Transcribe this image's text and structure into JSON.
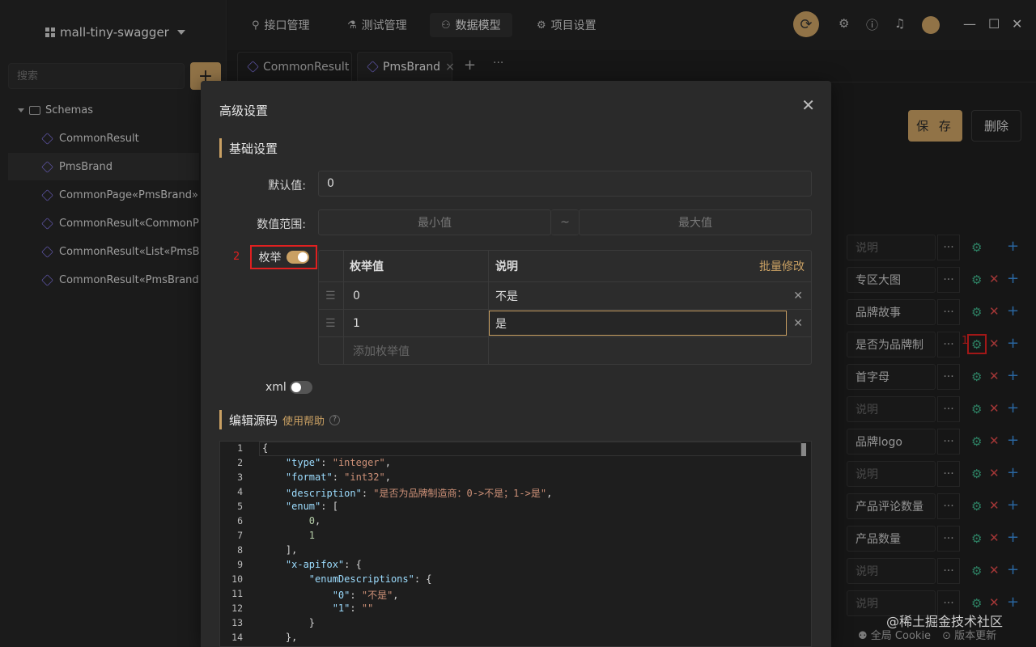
{
  "sidebar": {
    "project": "mall-tiny-swagger",
    "search_placeholder": "搜索",
    "add_label": "+",
    "folder": "Schemas",
    "items": [
      "CommonResult",
      "PmsBrand",
      "CommonPage«PmsBrand»",
      "CommonResult«CommonPage«PmsBrand»»",
      "CommonResult«List«PmsBrand»»",
      "CommonResult«PmsBrand»"
    ]
  },
  "topnav": {
    "tabs": [
      "接口管理",
      "测试管理",
      "数据模型",
      "项目设置"
    ]
  },
  "doctabs": [
    "CommonResult",
    "PmsBrand"
  ],
  "actions": {
    "save": "保 存",
    "delete": "删除"
  },
  "fields": [
    {
      "desc": "说明",
      "ph": true
    },
    {
      "desc": "专区大图"
    },
    {
      "desc": "品牌故事"
    },
    {
      "desc": "是否为品牌制"
    },
    {
      "desc": "首字母"
    },
    {
      "desc": "说明",
      "ph": true
    },
    {
      "desc": "品牌logo"
    },
    {
      "desc": "说明",
      "ph": true
    },
    {
      "desc": "产品评论数量"
    },
    {
      "desc": "产品数量"
    },
    {
      "desc": "说明",
      "ph": true
    },
    {
      "desc": "说明",
      "ph": true
    }
  ],
  "annotations": {
    "one": "1",
    "two": "2"
  },
  "modal": {
    "title": "高级设置",
    "basic": "基础设置",
    "default_label": "默认值:",
    "default_value": "0",
    "range_label": "数值范围:",
    "min_placeholder": "最小值",
    "tilde": "~",
    "max_placeholder": "最大值",
    "enum_label": "枚举",
    "enum_header_value": "枚举值",
    "enum_header_desc": "说明",
    "batch_edit": "批量修改",
    "enum_rows": [
      {
        "value": "0",
        "desc": "不是"
      },
      {
        "value": "1",
        "desc": "是"
      }
    ],
    "add_enum": "添加枚举值",
    "xml_label": "xml",
    "source_title": "编辑源码",
    "help": "使用帮助"
  },
  "code_lines": [
    "{",
    "    \"type\": \"integer\",",
    "    \"format\": \"int32\",",
    "    \"description\": \"是否为品牌制造商：0->不是；1->是\",",
    "    \"enum\": [",
    "        0,",
    "        1",
    "    ],",
    "    \"x-apifox\": {",
    "        \"enumDescriptions\": {",
    "            \"0\": \"不是\",",
    "            \"1\": \"\"",
    "        }",
    "    },"
  ],
  "footer": {
    "cookie": "全局 Cookie",
    "version": "版本更新",
    "watermark": "@稀土掘金技术社区"
  },
  "colors": {
    "accent": "#c9a063",
    "danger": "#e04b4b",
    "success": "#3fb28a",
    "info": "#3b8fe0",
    "annotation": "#e02020"
  }
}
